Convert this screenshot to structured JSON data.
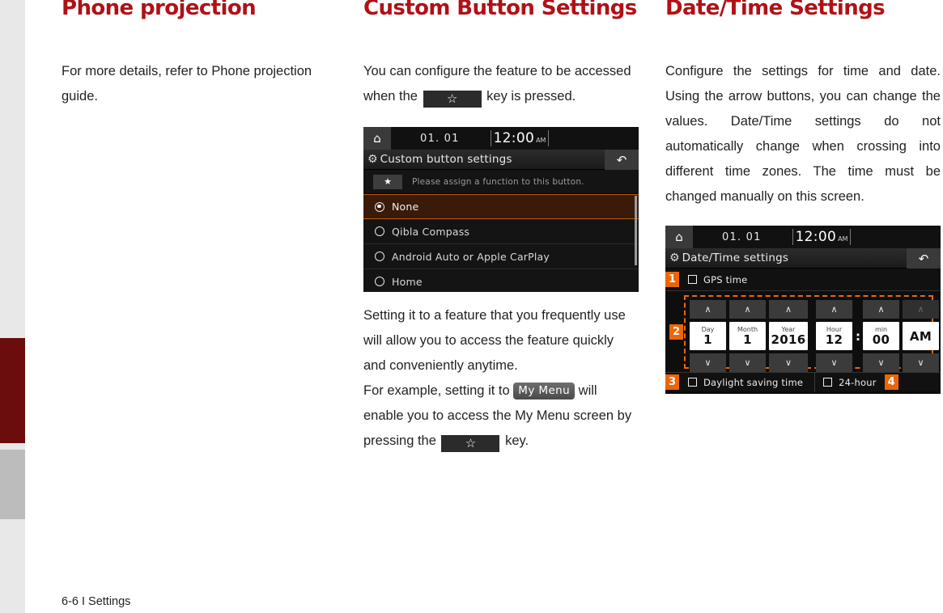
{
  "footer": {
    "text": "6-6 I Settings"
  },
  "sidebar": {
    "active_tab_color": "#6b0d0d",
    "inactive_tab_color": "#bcbcbc",
    "strip_color": "#e8e8e8"
  },
  "theme": {
    "heading_red": "#b01116",
    "accent_orange": "#ec6608"
  },
  "columns": {
    "left": {
      "title": "Phone projection",
      "paragraph": "For more details, refer to Phone projection guide."
    },
    "middle": {
      "title": "Custom Button Settings",
      "intro_before": "You can configure the feature to be accessed when the",
      "intro_after": "key is pressed.",
      "star_key_glyph": "☆",
      "paragraph_1": "Setting it to a feature that you frequently use will allow you to access the feature quickly and conveniently anytime.",
      "paragraph_2_before": "For example, setting it to",
      "my_menu_badge": "My Menu",
      "paragraph_2_mid": "will enable you to access the My Menu screen by pressing the",
      "paragraph_2_after": "key.",
      "screenshot": {
        "status": {
          "home_icon": "home-icon",
          "date": "01. 01",
          "time": "12:00",
          "meridiem": "AM"
        },
        "titlebar": {
          "gear_icon": "gear-icon",
          "title": "Custom button settings",
          "back_icon": "back-arrow-icon"
        },
        "assign_row": {
          "star_icon": "★",
          "text": "Please assign a function to this button."
        },
        "options": [
          {
            "label": "None",
            "selected": true
          },
          {
            "label": "Qibla Compass",
            "selected": false
          },
          {
            "label": "Android Auto or Apple CarPlay",
            "selected": false
          },
          {
            "label": "Home",
            "selected": false
          }
        ]
      }
    },
    "right": {
      "title": "Date/Time Settings",
      "paragraph": "Configure the settings for time and date. Using the arrow buttons, you can change the values. Date/Time settings do not automatically change when crossing into different time zones. The time must be changed manually on this screen.",
      "screenshot": {
        "status": {
          "home_icon": "home-icon",
          "date": "01. 01",
          "time": "12:00",
          "meridiem": "AM"
        },
        "titlebar": {
          "gear_icon": "gear-icon",
          "title": "Date/Time settings",
          "back_icon": "back-arrow-icon"
        },
        "gps_row": {
          "badge": "1",
          "label": "GPS time",
          "checked": false
        },
        "picker_badge": "2",
        "picker": [
          {
            "caption": "Day",
            "value": "1",
            "up": "∧",
            "down": "∨",
            "up_dim": false
          },
          {
            "caption": "Month",
            "value": "1",
            "up": "∧",
            "down": "∨",
            "up_dim": false
          },
          {
            "caption": "Year",
            "value": "2016",
            "up": "∧",
            "down": "∨",
            "up_dim": false
          },
          {
            "caption": "Hour",
            "value": "12",
            "up": "∧",
            "down": "∨",
            "up_dim": false
          },
          {
            "caption": "min",
            "value": "00",
            "up": "∧",
            "down": "∨",
            "up_dim": false
          },
          {
            "caption": "",
            "value": "AM",
            "up": "∧",
            "down": "∨",
            "up_dim": true
          }
        ],
        "colon": ":",
        "bottom": {
          "badge_left": "3",
          "label_left": "Daylight saving time",
          "checked_left": false,
          "label_right": "24-hour",
          "checked_right": false,
          "badge_right": "4"
        }
      }
    }
  }
}
